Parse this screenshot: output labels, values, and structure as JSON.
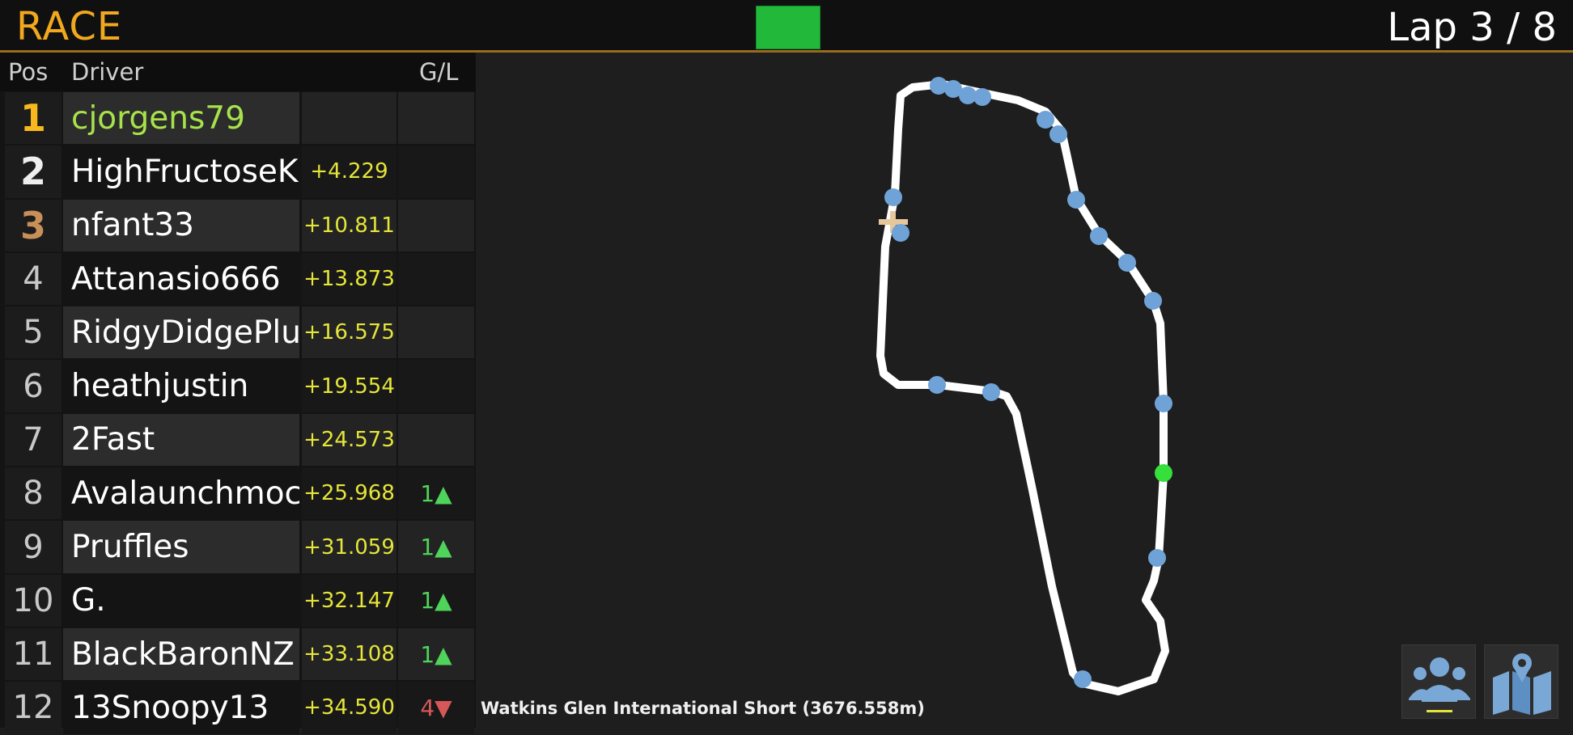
{
  "header": {
    "session": "RACE",
    "lap_text": "Lap 3 / 8",
    "flag_color": "#22b83a",
    "accent_color": "#f2a81e"
  },
  "columns": {
    "pos": "Pos",
    "driver": "Driver",
    "gl": "G/L"
  },
  "standings": [
    {
      "pos": "1",
      "driver": "cjorgens79",
      "gap": "",
      "gl": "",
      "gl_dir": ""
    },
    {
      "pos": "2",
      "driver": "HighFructoseK",
      "gap": "+4.229",
      "gl": "",
      "gl_dir": ""
    },
    {
      "pos": "3",
      "driver": "nfant33",
      "gap": "+10.811",
      "gl": "",
      "gl_dir": ""
    },
    {
      "pos": "4",
      "driver": "Attanasio666",
      "gap": "+13.873",
      "gl": "",
      "gl_dir": ""
    },
    {
      "pos": "5",
      "driver": "RidgyDidgePlu",
      "gap": "+16.575",
      "gl": "",
      "gl_dir": ""
    },
    {
      "pos": "6",
      "driver": "heathjustin",
      "gap": "+19.554",
      "gl": "",
      "gl_dir": ""
    },
    {
      "pos": "7",
      "driver": "2Fast",
      "gap": "+24.573",
      "gl": "",
      "gl_dir": ""
    },
    {
      "pos": "8",
      "driver": "Avalaunchmoc",
      "gap": "+25.968",
      "gl": "1▲",
      "gl_dir": "up"
    },
    {
      "pos": "9",
      "driver": "Pruffles",
      "gap": "+31.059",
      "gl": "1▲",
      "gl_dir": "up"
    },
    {
      "pos": "10",
      "driver": "G.",
      "gap": "+32.147",
      "gl": "1▲",
      "gl_dir": "up"
    },
    {
      "pos": "11",
      "driver": "BlackBaronNZ",
      "gap": "+33.108",
      "gl": "1▲",
      "gl_dir": "up"
    },
    {
      "pos": "12",
      "driver": "13Snoopy13",
      "gap": "+34.590",
      "gl": "4▼",
      "gl_dir": "down"
    }
  ],
  "track": {
    "name": "Watkins Glen International Short (3676.558m)",
    "line_color": "#ffffff",
    "car_color": "#6fa3d8",
    "player_color": "#35e03a"
  },
  "controls": {
    "drivers_icon": "drivers-group-icon",
    "map_icon": "track-map-icon"
  }
}
